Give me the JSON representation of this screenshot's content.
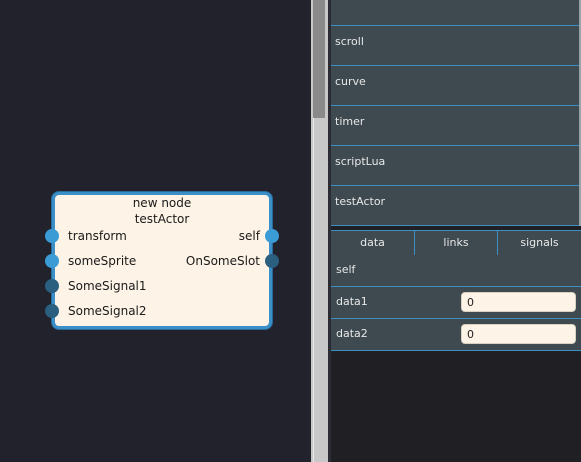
{
  "node": {
    "title_line1": "new node",
    "title_line2": "testActor",
    "inputs": [
      {
        "label": "transform",
        "style": "light"
      },
      {
        "label": "someSprite",
        "style": "light"
      },
      {
        "label": "SomeSignal1",
        "style": "dark"
      },
      {
        "label": "SomeSignal2",
        "style": "dark"
      }
    ],
    "outputs": [
      {
        "label": "self",
        "style": "light"
      },
      {
        "label": "OnSomeSlot",
        "style": "dark"
      }
    ]
  },
  "component_list": {
    "items": [
      "",
      "scroll",
      "curve",
      "timer",
      "scriptLua",
      "testActor"
    ]
  },
  "tabs": [
    "data",
    "links",
    "signals"
  ],
  "properties": [
    {
      "label": "self"
    },
    {
      "label": "data1",
      "value": "0"
    },
    {
      "label": "data2",
      "value": "0"
    }
  ],
  "colors": {
    "canvas_bg": "#22222c",
    "node_bg": "#fdf3e6",
    "node_border": "#3a8fc8",
    "port_light": "#3a9bd5",
    "port_dark": "#2a5f80",
    "panel_row": "#3e4a50",
    "row_border": "#3c8fc0"
  }
}
